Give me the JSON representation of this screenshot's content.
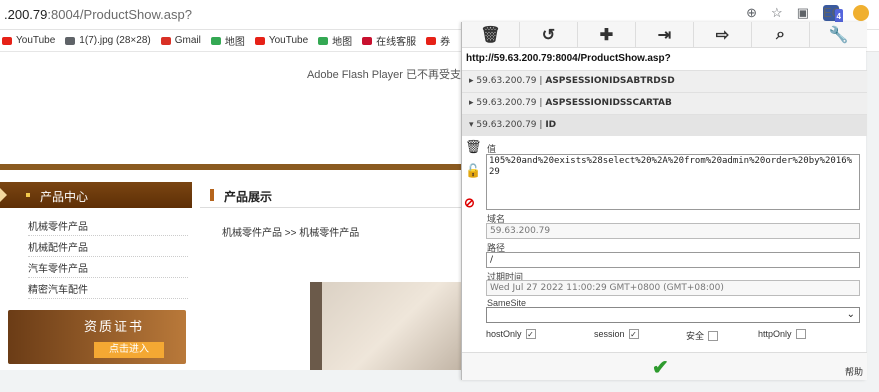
{
  "browser": {
    "url_host": ".200.79",
    "url_rest": ":8004/ProductShow.asp?",
    "icons": [
      "zoom-icon",
      "star-icon",
      "reader-icon",
      "extension-icon",
      "profile-icon"
    ],
    "ext_badge": "4",
    "ext_label": "EC"
  },
  "bookmarks": [
    {
      "label": "YouTube",
      "color": "#e62117"
    },
    {
      "label": "1(7).jpg (28×28)",
      "color": "#5f6368"
    },
    {
      "label": "Gmail",
      "color": "#d93025"
    },
    {
      "label": "地图",
      "color": "#34a853"
    },
    {
      "label": "YouTube",
      "color": "#e62117"
    },
    {
      "label": "地图",
      "color": "#34a853"
    },
    {
      "label": "在线客服",
      "color": "#c8102e"
    },
    {
      "label": "券",
      "color": "#e62117"
    }
  ],
  "page": {
    "flash_notice": "Adobe Flash Player 已不再受支",
    "side_title": "产品中心",
    "side_items": [
      "机械零件产品",
      "机械配件产品",
      "汽车零件产品",
      "精密汽车配件"
    ],
    "cert_title": "资质证书",
    "cert_button": "点击进入",
    "prod_title": "产品展示",
    "breadcrumb": "机械零件产品 >> 机械零件产品"
  },
  "panel": {
    "toolbar": [
      "🗑",
      "↺",
      "✚",
      "⇥",
      "⇨",
      "⌕",
      "🔧"
    ],
    "url": "http://59.63.200.79:8004/ProductShow.asp?",
    "cookies": [
      {
        "host": "59.63.200.79",
        "name": "ASPSESSIONIDSABTRDSD",
        "open": false,
        "arrow": "▸"
      },
      {
        "host": "59.63.200.79",
        "name": "ASPSESSIONIDSSCARTAB",
        "open": false,
        "arrow": "▸"
      },
      {
        "host": "59.63.200.79",
        "name": "ID",
        "open": true,
        "arrow": "▾"
      }
    ],
    "sep": "|",
    "value_label": "值",
    "value": "105%20and%20exists%28select%20%2A%20from%20admin%20order%20by%2016%29",
    "domain_label": "域名",
    "domain": "59.63.200.79",
    "path_label": "路径",
    "path": "/",
    "expires_label": "过期时间",
    "expires": "Wed Jul 27 2022 11:00:29 GMT+0800 (GMT+08:00)",
    "samesite_label": "SameSite",
    "samesite_value": "",
    "checks": [
      {
        "label": "hostOnly",
        "checked": true,
        "mark": "✓"
      },
      {
        "label": "session",
        "checked": true,
        "mark": "✓"
      },
      {
        "label": "安全",
        "checked": false,
        "mark": ""
      },
      {
        "label": "httpOnly",
        "checked": false,
        "mark": ""
      }
    ],
    "ok_glyph": "✔",
    "help": "帮助"
  }
}
